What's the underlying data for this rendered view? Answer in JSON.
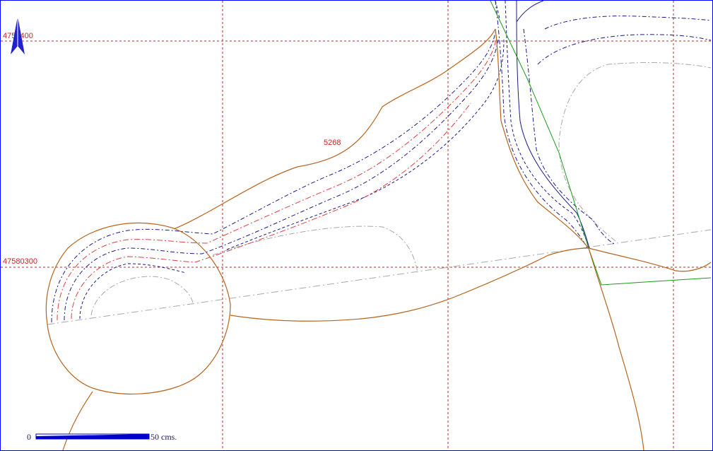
{
  "map": {
    "grid_labels": {
      "northing_top": "4758400",
      "northing_bottom": "47580300"
    },
    "contour_label": "5268",
    "north_arrow": "north-arrow-icon",
    "scale_bar": {
      "start_label": "0",
      "end_label": "50  cms."
    },
    "colors": {
      "grid": "#cc2222",
      "outline": "#b5651d",
      "contour_blue": "#1a1a8a",
      "contour_red": "#d94040",
      "contour_gray": "#a8a8a8",
      "section_line": "#1a9a1a",
      "frame": "#0000ff"
    }
  }
}
